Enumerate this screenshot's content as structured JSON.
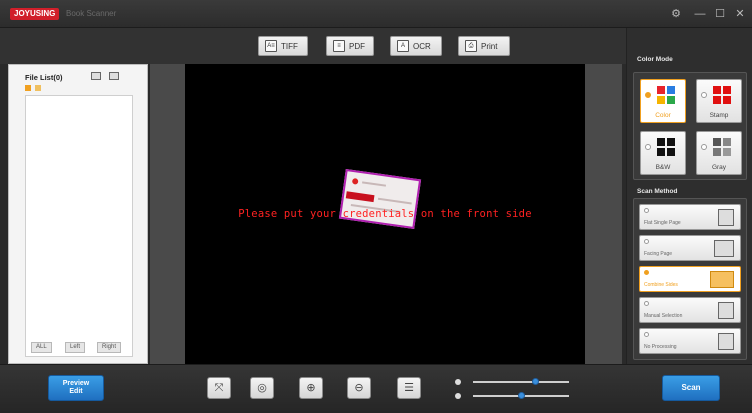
{
  "titlebar": {
    "logo_text": "JOYUSING",
    "app_title": "Book Scanner",
    "icons": [
      "gear-icon",
      "minimize-icon",
      "maximize-icon",
      "close-icon"
    ],
    "glyphs": {
      "gear": "⚙",
      "min": "—",
      "max": "☐",
      "close": "✕"
    }
  },
  "toolbar": {
    "buttons": [
      {
        "label": "TIFF",
        "icon": "A≡"
      },
      {
        "label": "PDF",
        "icon": "≡"
      },
      {
        "label": "OCR",
        "icon": "A"
      },
      {
        "label": "Print",
        "icon": "⎙"
      }
    ]
  },
  "file_list": {
    "title": "File List(0)",
    "filters": [
      "ALL",
      "Left",
      "Right"
    ]
  },
  "preview": {
    "message": "Please put your credentials on the front side"
  },
  "color_mode": {
    "title": "Color Mode",
    "selected": "Color",
    "options": [
      {
        "label": "Color",
        "colors": [
          "#e8232b",
          "#2a7de1",
          "#f5b400",
          "#2ba84a"
        ]
      },
      {
        "label": "Stamp",
        "colors": [
          "#e01010",
          "#e01010",
          "#e01010",
          "#e01010"
        ]
      },
      {
        "label": "B&W",
        "colors": [
          "#111111",
          "#111111",
          "#111111",
          "#111111"
        ]
      },
      {
        "label": "Gray",
        "colors": [
          "#555555",
          "#888888",
          "#777777",
          "#999999"
        ]
      }
    ]
  },
  "scan_method": {
    "title": "Scan Method",
    "selected": "Combine Sides",
    "options": [
      {
        "label": "Flat Single Page"
      },
      {
        "label": "Facing Page"
      },
      {
        "label": "Combine Sides"
      },
      {
        "label": "Manual Selection"
      },
      {
        "label": "No Processing"
      }
    ]
  },
  "bottom": {
    "preview_edit_line1": "Preview",
    "preview_edit_line2": "Edit",
    "scan_label": "Scan",
    "tools": [
      {
        "name": "fit-icon",
        "glyph": "⤧"
      },
      {
        "name": "rotate-icon",
        "glyph": "◎"
      },
      {
        "name": "zoom-in-icon",
        "glyph": "⊕"
      },
      {
        "name": "zoom-out-icon",
        "glyph": "⊖"
      },
      {
        "name": "adjust-icon",
        "glyph": "☰"
      }
    ],
    "sliders": [
      {
        "name": "brightness",
        "value": 0.65
      },
      {
        "name": "contrast",
        "value": 0.5
      }
    ]
  },
  "colors": {
    "accent_orange": "#f0a020",
    "blue_button": "#2a86d6",
    "hint_red": "#ff2222"
  }
}
